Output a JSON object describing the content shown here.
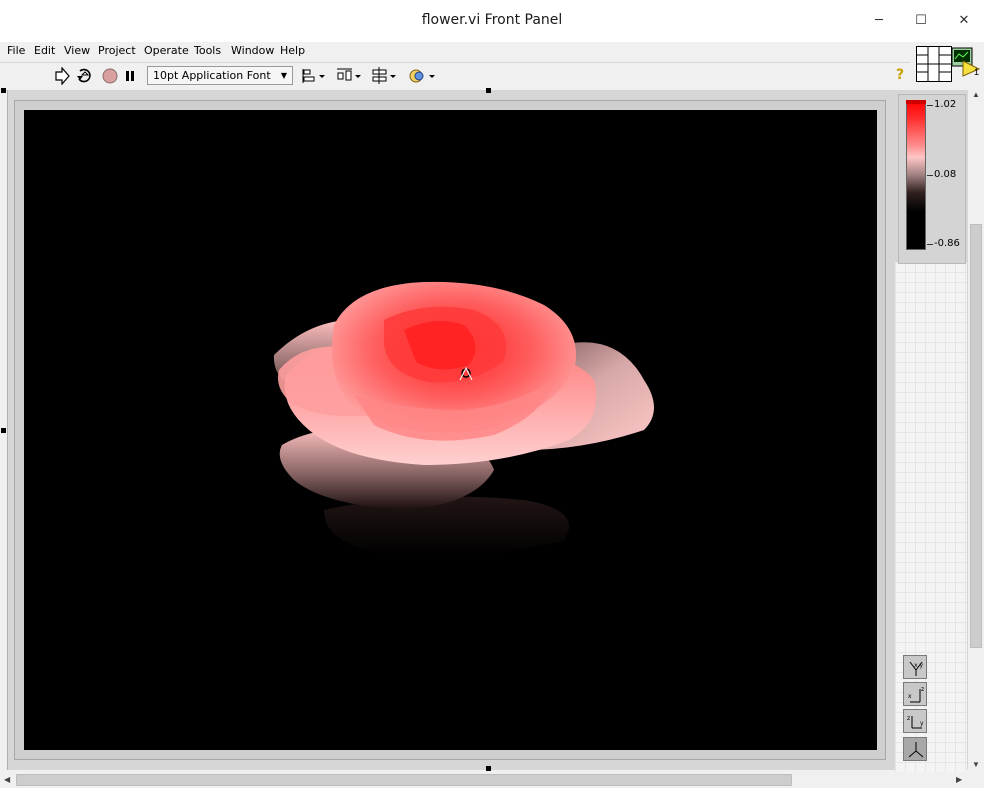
{
  "window": {
    "title": "flower.vi Front Panel",
    "minimize_glyph": "─",
    "maximize_glyph": "☐",
    "close_glyph": "✕"
  },
  "menu": [
    "File",
    "Edit",
    "View",
    "Project",
    "Operate",
    "Tools",
    "Window",
    "Help"
  ],
  "toolbar": {
    "font_selector": "10pt Application Font",
    "help_glyph": "?"
  },
  "vi_icon": {
    "number": "1"
  },
  "color_ramp": {
    "max_label": "1.02",
    "mid_label": "0.08",
    "min_label": "-0.86",
    "colors": {
      "high": "#ff0000",
      "mid": "#ffc0c0",
      "low": "#000000"
    }
  },
  "plot": {
    "background": "#000000",
    "subject": "rose-3d-surface"
  },
  "projection_buttons": [
    {
      "name": "xy-plane-view-button",
      "caption": "XY"
    },
    {
      "name": "xz-plane-view-button",
      "caption": "XZ"
    },
    {
      "name": "yz-plane-view-button",
      "caption": "YZ"
    },
    {
      "name": "3d-view-button",
      "caption": "3D"
    }
  ]
}
